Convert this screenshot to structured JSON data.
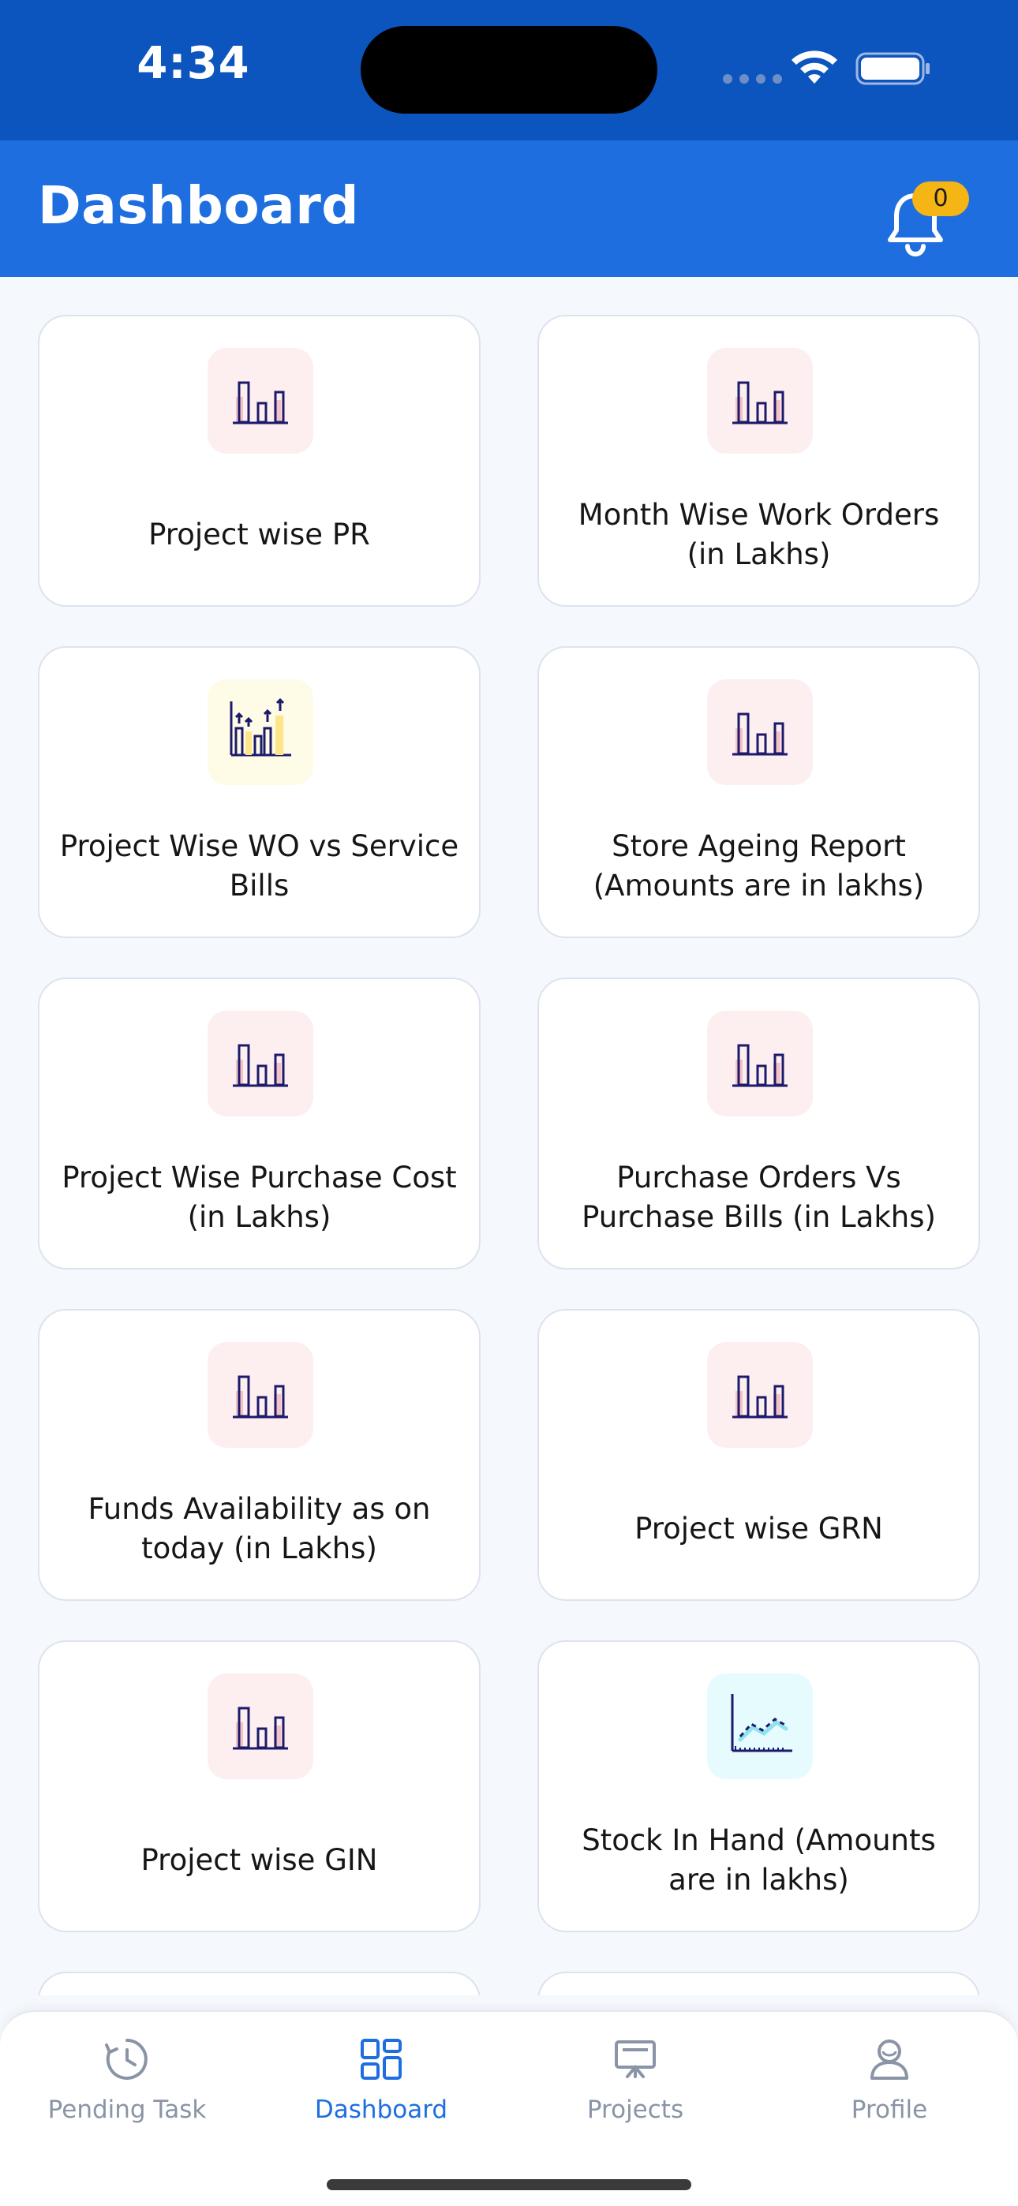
{
  "status_bar": {
    "time": "4:34"
  },
  "header": {
    "title": "Dashboard",
    "notification_count": "0"
  },
  "colors": {
    "primary": "#1E6EE0",
    "status_bar": "#0D55BE",
    "badge": "#F5B515",
    "icon_pink_bg": "#FDEFF0",
    "icon_yellow_bg": "#FEFBE6",
    "icon_cyan_bg": "#E6FBFD"
  },
  "cards": [
    {
      "label": "Project wise PR",
      "icon": "bar-chart-icon"
    },
    {
      "label": "Month Wise Work Orders (in Lakhs)",
      "icon": "bar-chart-icon"
    },
    {
      "label": "Project Wise WO vs Service Bills",
      "icon": "growth-bar-chart-icon"
    },
    {
      "label": "Store Ageing Report (Amounts are in lakhs)",
      "icon": "bar-chart-icon"
    },
    {
      "label": "Project Wise Purchase Cost (in Lakhs)",
      "icon": "bar-chart-icon"
    },
    {
      "label": "Purchase Orders Vs Purchase Bills (in Lakhs)",
      "icon": "bar-chart-icon"
    },
    {
      "label": "Funds Availability as on today (in Lakhs)",
      "icon": "bar-chart-icon"
    },
    {
      "label": "Project wise GRN",
      "icon": "bar-chart-icon"
    },
    {
      "label": "Project wise GIN",
      "icon": "bar-chart-icon"
    },
    {
      "label": "Stock In Hand (Amounts are in lakhs)",
      "icon": "line-chart-icon"
    }
  ],
  "bottom_nav": [
    {
      "label": "Pending Task",
      "icon": "clock-icon",
      "active": false
    },
    {
      "label": "Dashboard",
      "icon": "dashboard-icon",
      "active": true
    },
    {
      "label": "Projects",
      "icon": "presentation-board-icon",
      "active": false
    },
    {
      "label": "Profile",
      "icon": "user-icon",
      "active": false
    }
  ]
}
